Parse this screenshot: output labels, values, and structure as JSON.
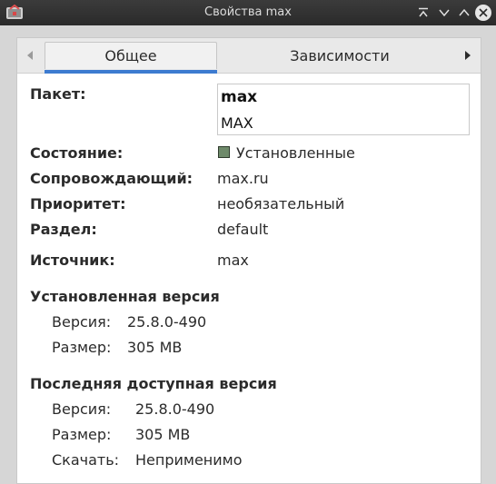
{
  "window": {
    "title": "Свойства max"
  },
  "tabs": [
    {
      "label": "Общее",
      "active": true
    },
    {
      "label": "Зависимости",
      "active": false
    }
  ],
  "package": {
    "label": "Пакет:",
    "name": "max",
    "description": "MAX"
  },
  "fields": {
    "status_label": "Состояние:",
    "status_value": "Установленные",
    "status_color": "#6e8a6a",
    "maintainer_label": "Сопровождающий:",
    "maintainer_value": "max.ru",
    "priority_label": "Приоритет:",
    "priority_value": "необязательный",
    "section_label": "Раздел:",
    "section_value": "default",
    "source_label": "Источник:",
    "source_value": "max"
  },
  "installed": {
    "title": "Установленная версия",
    "version_label": "Версия:",
    "version_value": "25.8.0-490",
    "size_label": "Размер:",
    "size_value": "305 MB"
  },
  "latest": {
    "title": "Последняя доступная версия",
    "version_label": "Версия:",
    "version_value": "25.8.0-490",
    "size_label": "Размер:",
    "size_value": "305 MB",
    "download_label": "Скачать:",
    "download_value": "Неприменимо"
  },
  "colors": {
    "accent": "#3d7bd0",
    "titlebar": "#2f2f2f"
  },
  "icons": {
    "app": "app-icon",
    "minimize": "minimize-icon",
    "shade": "chevron-down-icon",
    "maximize": "chevron-up-icon",
    "close": "close-icon",
    "tab_left": "arrow-left-icon",
    "tab_right": "arrow-right-icon"
  }
}
